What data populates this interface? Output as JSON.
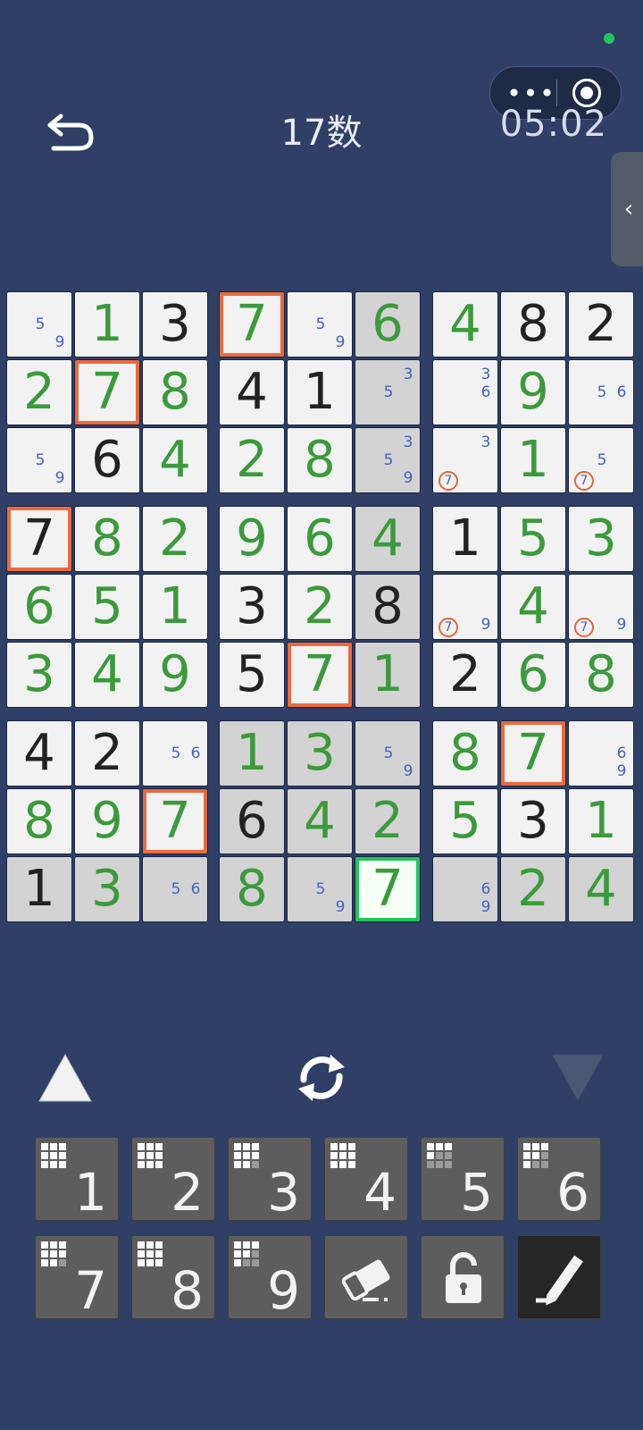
{
  "header": {
    "title": "17数",
    "timer": "05:02",
    "capsule_more": "•••"
  },
  "side_tab": {
    "label": "‹"
  },
  "board": {
    "values": [
      [
        "",
        "1",
        "3",
        "7",
        "",
        "6",
        "4",
        "8",
        "2"
      ],
      [
        "2",
        "7",
        "8",
        "4",
        "1",
        "",
        "",
        "9",
        ""
      ],
      [
        "",
        "6",
        "4",
        "2",
        "8",
        "",
        "",
        "1",
        ""
      ],
      [
        "7",
        "8",
        "2",
        "9",
        "6",
        "4",
        "1",
        "5",
        "3"
      ],
      [
        "6",
        "5",
        "1",
        "3",
        "2",
        "8",
        "",
        "4",
        ""
      ],
      [
        "3",
        "4",
        "9",
        "5",
        "7",
        "1",
        "2",
        "6",
        "8"
      ],
      [
        "4",
        "2",
        "",
        "1",
        "3",
        "",
        "8",
        "7",
        ""
      ],
      [
        "8",
        "9",
        "7",
        "6",
        "4",
        "2",
        "5",
        "3",
        "1"
      ],
      [
        "1",
        "3",
        "",
        "8",
        "",
        "7",
        "",
        "2",
        "4"
      ]
    ],
    "kinds": [
      [
        "n",
        "u",
        "g",
        "u",
        "n",
        "u",
        "u",
        "g",
        "g"
      ],
      [
        "u",
        "u",
        "u",
        "g",
        "g",
        "n",
        "n",
        "u",
        "n"
      ],
      [
        "n",
        "g",
        "u",
        "u",
        "u",
        "n",
        "n",
        "u",
        "n"
      ],
      [
        "g",
        "u",
        "u",
        "u",
        "u",
        "u",
        "g",
        "u",
        "u"
      ],
      [
        "u",
        "u",
        "u",
        "g",
        "u",
        "g",
        "n",
        "u",
        "n"
      ],
      [
        "u",
        "u",
        "u",
        "g",
        "u",
        "u",
        "g",
        "u",
        "u"
      ],
      [
        "g",
        "g",
        "n",
        "u",
        "u",
        "n",
        "u",
        "u",
        "n"
      ],
      [
        "u",
        "u",
        "u",
        "g",
        "u",
        "u",
        "u",
        "g",
        "u"
      ],
      [
        "g",
        "u",
        "n",
        "u",
        "n",
        "u",
        "n",
        "u",
        "u"
      ]
    ],
    "gray_cells": [
      [
        0,
        5
      ],
      [
        1,
        5
      ],
      [
        2,
        5
      ],
      [
        3,
        5
      ],
      [
        4,
        5
      ],
      [
        5,
        5
      ],
      [
        6,
        3
      ],
      [
        6,
        4
      ],
      [
        6,
        5
      ],
      [
        7,
        3
      ],
      [
        7,
        4
      ],
      [
        7,
        5
      ],
      [
        8,
        0
      ],
      [
        8,
        1
      ],
      [
        8,
        2
      ],
      [
        8,
        3
      ],
      [
        8,
        4
      ],
      [
        8,
        6
      ],
      [
        8,
        7
      ],
      [
        8,
        8
      ]
    ],
    "orange_cells": [
      [
        0,
        3
      ],
      [
        1,
        1
      ],
      [
        3,
        0
      ],
      [
        5,
        4
      ],
      [
        6,
        7
      ],
      [
        7,
        2
      ]
    ],
    "selected_cell": [
      8,
      5
    ],
    "notes": [
      {
        "r": 0,
        "c": 0,
        "digits": [
          "5",
          "9"
        ]
      },
      {
        "r": 0,
        "c": 4,
        "digits": [
          "5",
          "9"
        ]
      },
      {
        "r": 1,
        "c": 5,
        "digits": [
          "3",
          "5"
        ]
      },
      {
        "r": 1,
        "c": 6,
        "digits": [
          "3",
          "6"
        ]
      },
      {
        "r": 1,
        "c": 8,
        "digits": [
          "5",
          "6"
        ]
      },
      {
        "r": 2,
        "c": 0,
        "digits": [
          "5",
          "9"
        ]
      },
      {
        "r": 2,
        "c": 5,
        "digits": [
          "3",
          "5",
          "9"
        ]
      },
      {
        "r": 2,
        "c": 6,
        "digits": [
          "3",
          "7"
        ],
        "circled": "7"
      },
      {
        "r": 2,
        "c": 8,
        "digits": [
          "5",
          "7"
        ],
        "circled": "7"
      },
      {
        "r": 4,
        "c": 6,
        "digits": [
          "7",
          "9"
        ],
        "circled": "7"
      },
      {
        "r": 4,
        "c": 8,
        "digits": [
          "7",
          "9"
        ],
        "circled": "7"
      },
      {
        "r": 6,
        "c": 2,
        "digits": [
          "5",
          "6"
        ]
      },
      {
        "r": 6,
        "c": 5,
        "digits": [
          "5",
          "9"
        ]
      },
      {
        "r": 6,
        "c": 8,
        "digits": [
          "6",
          "9"
        ]
      },
      {
        "r": 8,
        "c": 2,
        "digits": [
          "5",
          "6"
        ]
      },
      {
        "r": 8,
        "c": 4,
        "digits": [
          "5",
          "9"
        ]
      },
      {
        "r": 8,
        "c": 6,
        "digits": [
          "6",
          "9"
        ]
      }
    ]
  },
  "colors": {
    "background": "#2f3f66",
    "given_digit": "#222222",
    "user_digit": "#3b9a3b",
    "note_digit": "#4a5fbf",
    "highlight_orange": "#ea6a3d",
    "selected_green": "#22c55e"
  },
  "controls": {
    "up_icon": "triangle-up-icon",
    "refresh_icon": "refresh-icon",
    "down_icon": "triangle-down-icon"
  },
  "keypad": {
    "digits": [
      "1",
      "2",
      "3",
      "4",
      "5",
      "6",
      "7",
      "8",
      "9"
    ],
    "remaining_mask": [
      [
        1,
        1,
        1,
        1,
        1,
        1,
        1,
        1,
        1
      ],
      [
        1,
        1,
        1,
        1,
        1,
        1,
        1,
        1,
        1
      ],
      [
        1,
        1,
        1,
        1,
        1,
        1,
        1,
        1,
        0
      ],
      [
        1,
        1,
        1,
        1,
        1,
        1,
        1,
        1,
        1
      ],
      [
        1,
        1,
        1,
        1,
        0,
        0,
        0,
        0,
        0
      ],
      [
        1,
        1,
        1,
        1,
        1,
        0,
        1,
        0,
        0
      ],
      [
        1,
        1,
        1,
        1,
        1,
        1,
        1,
        1,
        0
      ],
      [
        1,
        1,
        1,
        1,
        1,
        1,
        1,
        1,
        1
      ],
      [
        1,
        1,
        1,
        1,
        1,
        0,
        1,
        0,
        0
      ]
    ],
    "tools": [
      "eraser-icon",
      "lock-icon",
      "pencil-icon"
    ]
  }
}
